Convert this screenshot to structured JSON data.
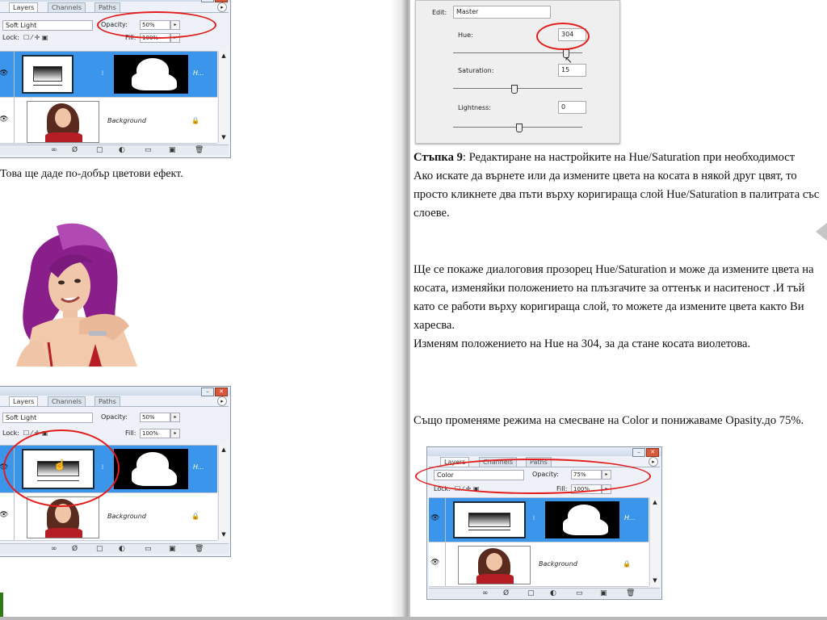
{
  "left_page": {
    "panel_top": {
      "tabs": [
        "Layers",
        "Channels",
        "Paths"
      ],
      "blend_mode": "Soft Light",
      "opacity_label": "Opacity:",
      "opacity_value": "50%",
      "lock_label": "Lock:",
      "fill_label": "Fill:",
      "fill_value": "100%",
      "mask_layer_name": "H...",
      "background_name": "Background"
    },
    "caption": "Това ще даде по-добър цветови ефект.",
    "panel_bottom": {
      "tabs": [
        "Layers",
        "Channels",
        "Paths"
      ],
      "blend_mode": "Soft Light",
      "opacity_label": "Opacity:",
      "opacity_value": "50%",
      "lock_label": "Lock:",
      "fill_label": "Fill:",
      "fill_value": "100%",
      "mask_layer_name": "H...",
      "background_name": "Background"
    }
  },
  "right_page": {
    "hue_dialog": {
      "edit_label": "Edit:",
      "edit_value": "Master",
      "hue_label": "Hue:",
      "hue_value": "304",
      "saturation_label": "Saturation:",
      "saturation_value": "15",
      "lightness_label": "Lightness:",
      "lightness_value": "0"
    },
    "step_heading": "Стъпка 9",
    "step_heading_rest": ": Редактиране на настройките на Hue/Saturation при необходимост",
    "para1": "Ако искате да върнете или да измените цвета на косата в някой друг цвят, то просто кликнете два пъти върху коригираща слой Hue/Saturation в палитрата със слоеве.",
    "para2": "Ще се покаже диалоговия прозорец Hue/Saturation и може да измените цвета на косата, изменяйки положението на плъзгачите за оттенък и наситеност .И тъй като се работи върху коригираща слой, то можете да измените цвета както Ви харесва.",
    "para3": "Изменям положението на Hue на 304, за да стане косата виолетова.",
    "para4": "Също променяме режима на смесване на Color и понижаваме Opasity.до 75%.",
    "panel": {
      "tabs": [
        "Layers",
        "Channels",
        "Paths"
      ],
      "blend_mode": "Color",
      "opacity_label": "Opacity:",
      "opacity_value": "75%",
      "lock_label": "Lock:",
      "fill_label": "Fill:",
      "fill_value": "100%",
      "mask_layer_name": "H...",
      "background_name": "Background"
    }
  },
  "colors": {
    "annotation": "#e31c1c",
    "selected_layer": "#3b95ea",
    "hair_purple": "#8a1f8c"
  }
}
